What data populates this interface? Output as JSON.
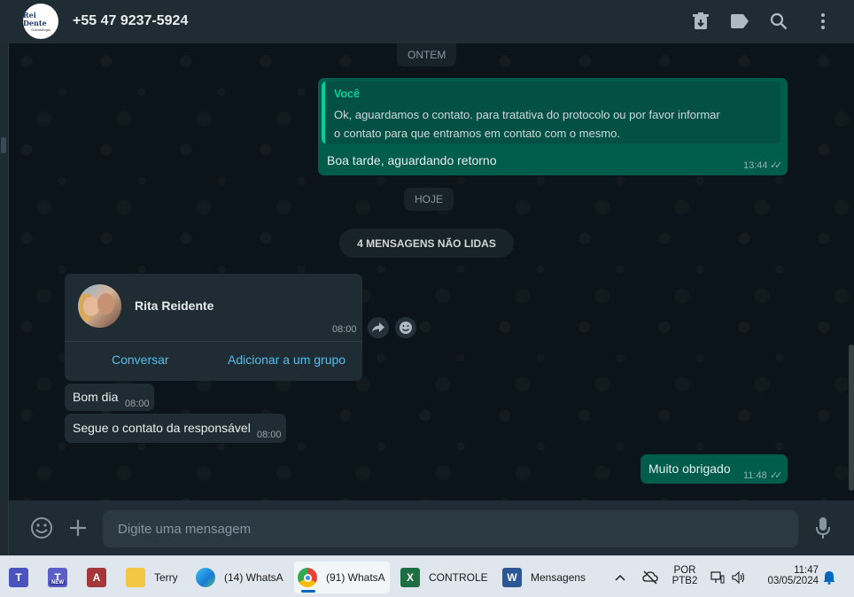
{
  "header": {
    "avatar_logo_text": "Rei Dente",
    "avatar_logo_sub": "Odontologia",
    "contact_name": "+55 47 9237-5924",
    "icons": [
      "archive-icon",
      "label-icon",
      "search-icon",
      "menu-icon"
    ]
  },
  "chat": {
    "date_yesterday": "ONTEM",
    "outgoing_quoted": {
      "author": "Você",
      "quoted_text": "Ok, aguardamos o contato. para tratativa do protocolo ou por favor informar o contato para que entramos em contato com o mesmo.",
      "text": "Boa tarde, aguardando retorno",
      "time": "13:44",
      "ticks": "✓✓"
    },
    "date_today": "HOJE",
    "unread_label": "4 MENSAGENS NÃO LIDAS",
    "contact_card": {
      "name": "Rita Reidente",
      "time": "08:00",
      "btn_chat": "Conversar",
      "btn_add_group": "Adicionar a um grupo"
    },
    "incoming": [
      {
        "text": "Bom dia",
        "time": "08:00"
      },
      {
        "text": "Segue o contato da responsável",
        "time": "08:00"
      }
    ],
    "outgoing_last": {
      "text": "Muito obrigado",
      "time": "11:48",
      "ticks": "✓✓"
    }
  },
  "footer": {
    "placeholder": "Digite uma mensagem"
  },
  "taskbar": {
    "apps": [
      {
        "name": "Teams",
        "label": ""
      },
      {
        "name": "Teams New",
        "label": "",
        "badge": "NEW"
      },
      {
        "name": "Access",
        "label": ""
      },
      {
        "name": "Explorer",
        "label": "Terry"
      },
      {
        "name": "Edge",
        "label": "(14) WhatsA"
      },
      {
        "name": "Chrome",
        "label": "(91) WhatsA"
      },
      {
        "name": "Excel",
        "label": "CONTROLE"
      },
      {
        "name": "Word",
        "label": "Mensagens"
      }
    ],
    "lang_top": "POR",
    "lang_bottom": "PTB2",
    "clock_time": "11:47",
    "clock_date": "03/05/2024"
  }
}
